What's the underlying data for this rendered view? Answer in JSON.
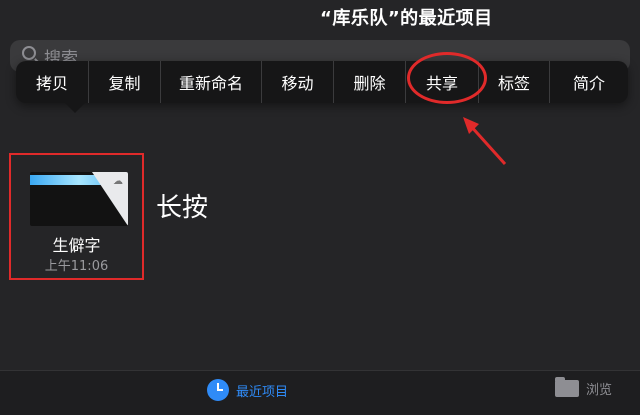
{
  "header": {
    "title": "“库乐队”的最近项目"
  },
  "search": {
    "placeholder": "搜索"
  },
  "context_menu": {
    "items": [
      {
        "label": "拷贝"
      },
      {
        "label": "复制"
      },
      {
        "label": "重新命名"
      },
      {
        "label": "移动"
      },
      {
        "label": "删除"
      },
      {
        "label": "共享"
      },
      {
        "label": "标签"
      },
      {
        "label": "简介"
      }
    ]
  },
  "file": {
    "name": "生僻字",
    "time": "上午11:06"
  },
  "annotation": {
    "text": "长按"
  },
  "tabbar": {
    "recent_label": "最近项目",
    "browse_label": "浏览"
  },
  "colors": {
    "accent": "#2f8bf7",
    "highlight": "#e02a2a",
    "background": "#252527",
    "menu_background": "#161617"
  }
}
